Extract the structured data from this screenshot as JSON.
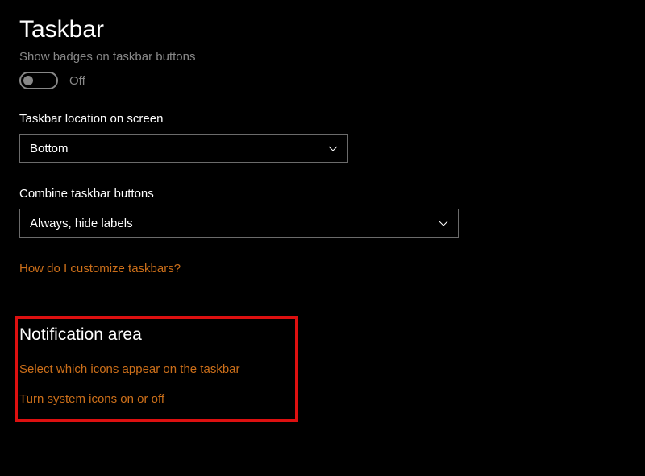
{
  "title": "Taskbar",
  "badges": {
    "label": "Show badges on taskbar buttons",
    "state": "Off"
  },
  "location": {
    "label": "Taskbar location on screen",
    "value": "Bottom"
  },
  "combine": {
    "label": "Combine taskbar buttons",
    "value": "Always, hide labels"
  },
  "links": {
    "customize": "How do I customize taskbars?"
  },
  "notification": {
    "heading": "Notification area",
    "select_icons": "Select which icons appear on the taskbar",
    "system_icons": "Turn system icons on or off"
  },
  "colors": {
    "accent": "#cc6f1a",
    "highlight_border": "#dd1010"
  }
}
